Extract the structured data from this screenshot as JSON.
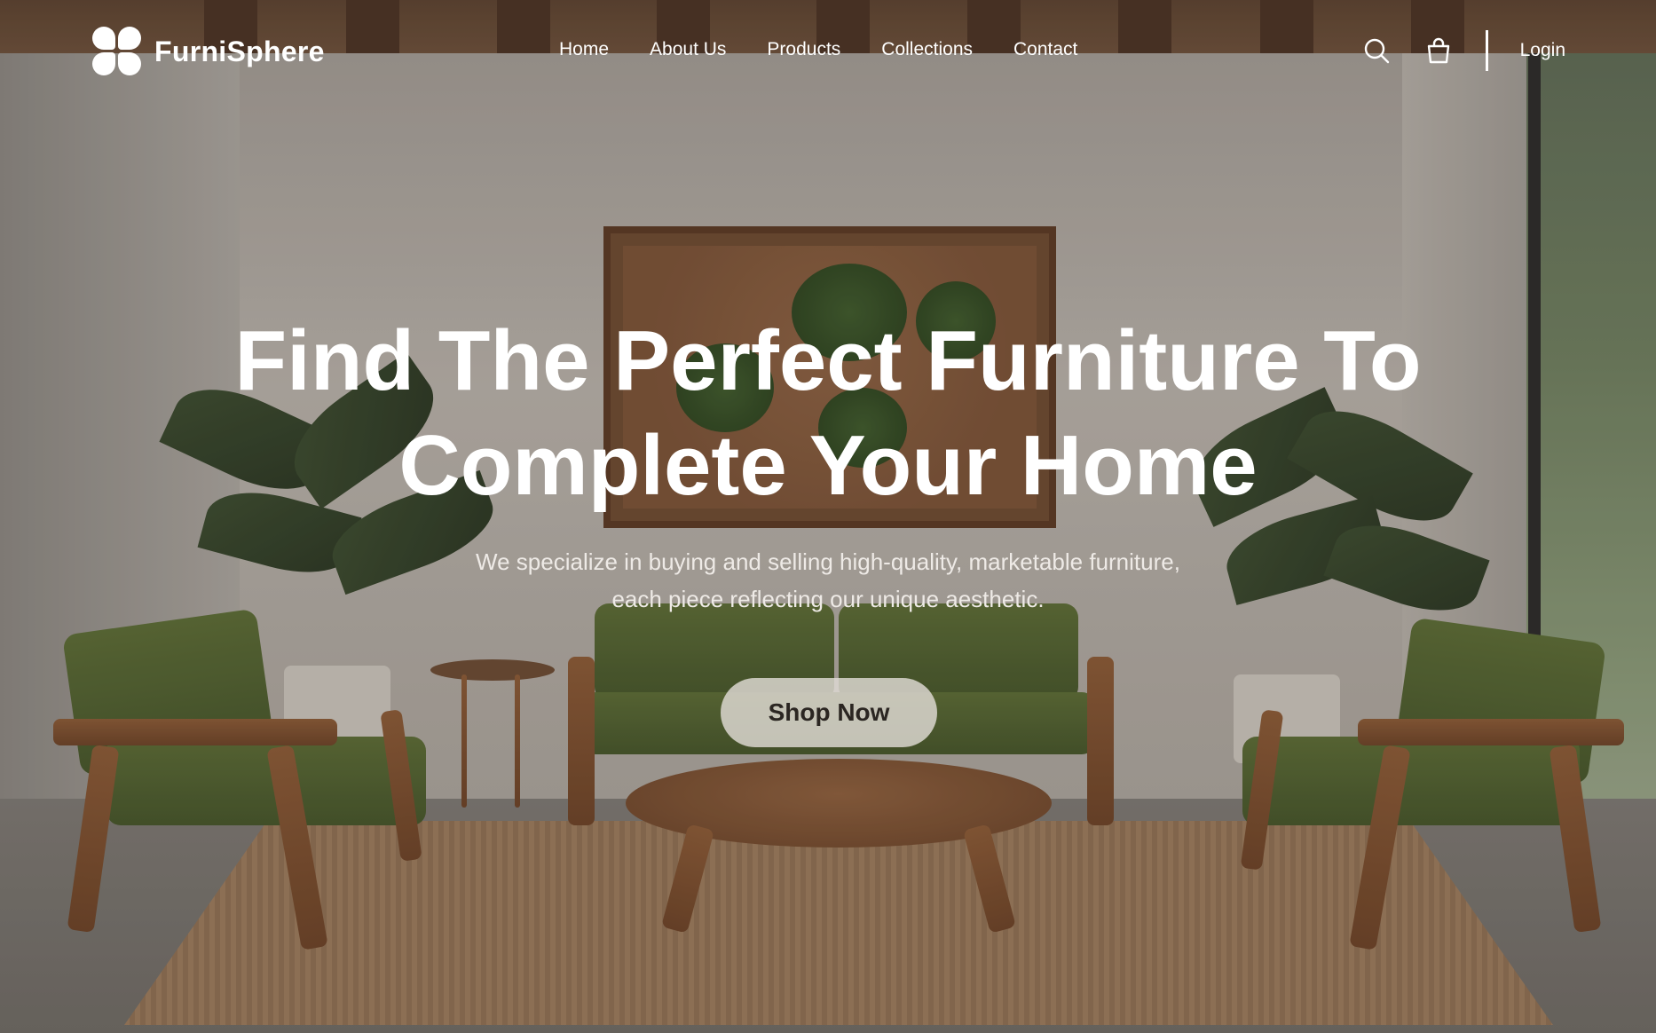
{
  "brand": {
    "name": "FurniSphere"
  },
  "nav": {
    "items": [
      {
        "label": "Home"
      },
      {
        "label": "About Us"
      },
      {
        "label": "Products"
      },
      {
        "label": "Collections"
      },
      {
        "label": "Contact"
      }
    ],
    "search_icon": "search-icon",
    "bag_icon": "shopping-bag-icon",
    "login_label": "Login"
  },
  "hero": {
    "headline_line1": "Find The Perfect Furniture To",
    "headline_line2": "Complete Your Home",
    "subtext_line1": "We specialize in buying and selling high-quality, marketable furniture,",
    "subtext_line2": "each piece reflecting our unique aesthetic.",
    "cta_label": "Shop Now"
  },
  "colors": {
    "text": "#ffffff",
    "cta_bg": "#e1dcd6",
    "cta_text": "#2b2622",
    "upholstery": "#4f5f2e",
    "wood": "#7a4e2f"
  }
}
